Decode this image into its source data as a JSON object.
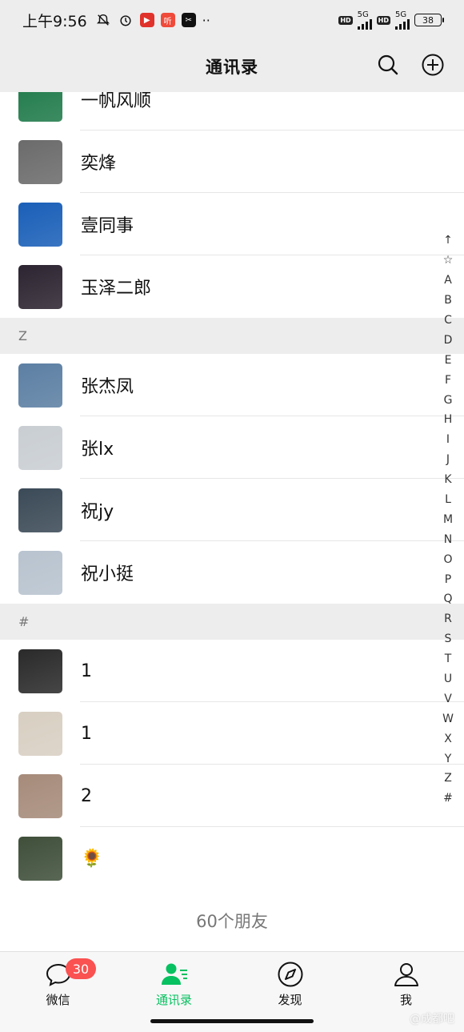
{
  "status_bar": {
    "time": "上午9:56",
    "network1": "5G",
    "network2": "5G",
    "battery": "38",
    "app_icons": [
      "mute-bell-icon",
      "alarm-icon",
      "weibo-icon",
      "ting-app-icon",
      "capcut-icon"
    ],
    "more": "··"
  },
  "header": {
    "title": "通讯录"
  },
  "contacts_top": [
    {
      "name": "一帆风顺",
      "avatar_color": "#1f7a4a"
    },
    {
      "name": "奕烽",
      "avatar_color": "#6b6b6b"
    },
    {
      "name": "壹同事",
      "avatar_color": "#1a5fb8"
    },
    {
      "name": "玉泽二郎",
      "avatar_color": "#2c2430"
    }
  ],
  "section_z": {
    "letter": "Z",
    "contacts": [
      {
        "name": "张杰凤",
        "avatar_color": "#5c7fa3"
      },
      {
        "name": "张lx",
        "avatar_color": "#c9ced3"
      },
      {
        "name": "祝jy",
        "avatar_color": "#3b4a57"
      },
      {
        "name": "祝小挺",
        "avatar_color": "#b8c3cf"
      }
    ]
  },
  "section_hash": {
    "letter": "#",
    "contacts": [
      {
        "name": "1",
        "avatar_color": "#2a2a2a"
      },
      {
        "name": "1",
        "avatar_color": "#d8cfc2"
      },
      {
        "name": "2",
        "avatar_color": "#a68b7a"
      },
      {
        "name": "🌻",
        "avatar_color": "#3f4f3a"
      }
    ]
  },
  "footer": {
    "count": "60个朋友"
  },
  "index_bar": [
    "↑",
    "☆",
    "A",
    "B",
    "C",
    "D",
    "E",
    "F",
    "G",
    "H",
    "I",
    "J",
    "K",
    "L",
    "M",
    "N",
    "O",
    "P",
    "Q",
    "R",
    "S",
    "T",
    "U",
    "V",
    "W",
    "X",
    "Y",
    "Z",
    "#"
  ],
  "tabs": [
    {
      "label": "微信",
      "badge": "30"
    },
    {
      "label": "通讯录"
    },
    {
      "label": "发现"
    },
    {
      "label": "我"
    }
  ],
  "colors": {
    "accent": "#07c160",
    "badge": "#fa5151",
    "background": "#ededed"
  },
  "watermark": "@成都吧"
}
